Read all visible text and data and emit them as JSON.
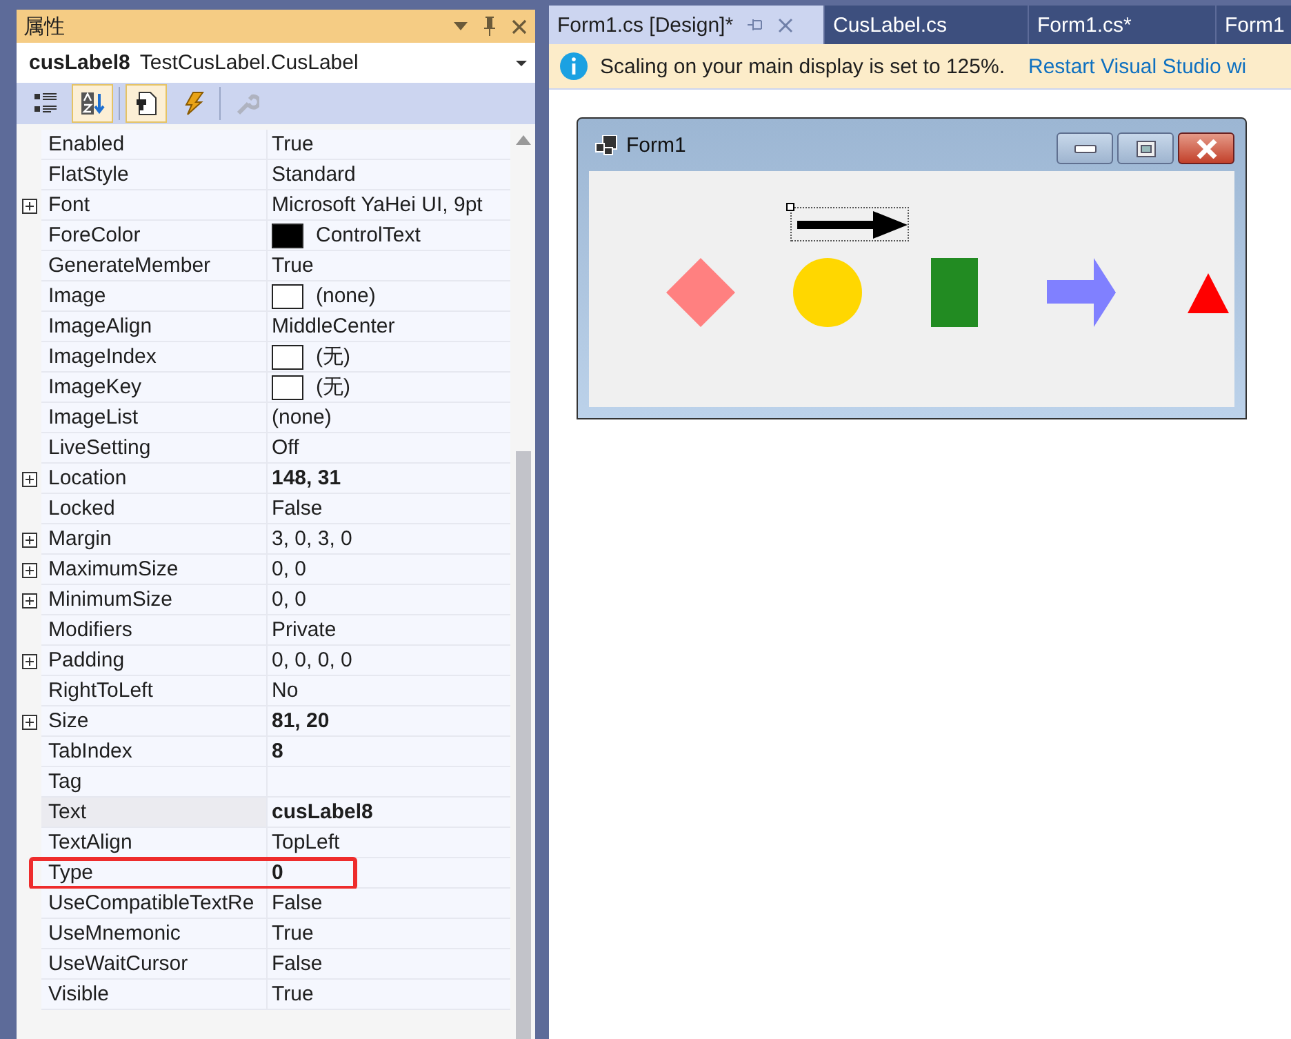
{
  "properties_panel": {
    "title": "属性",
    "object_name": "cusLabel8",
    "object_type": "TestCusLabel.CusLabel",
    "toolbar": [
      {
        "kind": "categorized",
        "selected": false,
        "disabled": false
      },
      {
        "kind": "alphabetical",
        "selected": true,
        "disabled": false
      },
      {
        "kind": "properties",
        "selected": true,
        "disabled": false
      },
      {
        "kind": "events",
        "selected": false,
        "disabled": false
      },
      {
        "kind": "property-pages",
        "selected": false,
        "disabled": true
      }
    ],
    "rows": [
      {
        "name": "Enabled",
        "value": "True",
        "expandable": false,
        "bold": false,
        "selected": false,
        "highlighted": false
      },
      {
        "name": "FlatStyle",
        "value": "Standard",
        "expandable": false,
        "bold": false,
        "selected": false,
        "highlighted": false
      },
      {
        "name": "Font",
        "value": "Microsoft YaHei UI, 9pt",
        "expandable": true,
        "bold": false,
        "selected": false,
        "highlighted": false
      },
      {
        "name": "ForeColor",
        "value": "ControlText",
        "color": "#000000",
        "expandable": false,
        "bold": false,
        "selected": false,
        "highlighted": false
      },
      {
        "name": "GenerateMember",
        "value": "True",
        "expandable": false,
        "bold": false,
        "selected": false,
        "highlighted": false
      },
      {
        "name": "Image",
        "value": "(none)",
        "color": "#ffffff",
        "expandable": false,
        "bold": false,
        "selected": false,
        "highlighted": false
      },
      {
        "name": "ImageAlign",
        "value": "MiddleCenter",
        "expandable": false,
        "bold": false,
        "selected": false,
        "highlighted": false
      },
      {
        "name": "ImageIndex",
        "value": "(无)",
        "color": "#ffffff",
        "expandable": false,
        "bold": false,
        "selected": false,
        "highlighted": false
      },
      {
        "name": "ImageKey",
        "value": "(无)",
        "color": "#ffffff",
        "expandable": false,
        "bold": false,
        "selected": false,
        "highlighted": false
      },
      {
        "name": "ImageList",
        "value": "(none)",
        "expandable": false,
        "bold": false,
        "selected": false,
        "highlighted": false
      },
      {
        "name": "LiveSetting",
        "value": "Off",
        "expandable": false,
        "bold": false,
        "selected": false,
        "highlighted": false
      },
      {
        "name": "Location",
        "value": "148, 31",
        "expandable": true,
        "bold": true,
        "selected": false,
        "highlighted": false
      },
      {
        "name": "Locked",
        "value": "False",
        "expandable": false,
        "bold": false,
        "selected": false,
        "highlighted": false
      },
      {
        "name": "Margin",
        "value": "3, 0, 3, 0",
        "expandable": true,
        "bold": false,
        "selected": false,
        "highlighted": false
      },
      {
        "name": "MaximumSize",
        "value": "0, 0",
        "expandable": true,
        "bold": false,
        "selected": false,
        "highlighted": false
      },
      {
        "name": "MinimumSize",
        "value": "0, 0",
        "expandable": true,
        "bold": false,
        "selected": false,
        "highlighted": false
      },
      {
        "name": "Modifiers",
        "value": "Private",
        "expandable": false,
        "bold": false,
        "selected": false,
        "highlighted": false
      },
      {
        "name": "Padding",
        "value": "0, 0, 0, 0",
        "expandable": true,
        "bold": false,
        "selected": false,
        "highlighted": false
      },
      {
        "name": "RightToLeft",
        "value": "No",
        "expandable": false,
        "bold": false,
        "selected": false,
        "highlighted": false
      },
      {
        "name": "Size",
        "value": "81, 20",
        "expandable": true,
        "bold": true,
        "selected": false,
        "highlighted": false
      },
      {
        "name": "TabIndex",
        "value": "8",
        "expandable": false,
        "bold": true,
        "selected": false,
        "highlighted": false
      },
      {
        "name": "Tag",
        "expandable": false,
        "selected": false,
        "highlighted": false
      },
      {
        "name": "Text",
        "value": "cusLabel8",
        "expandable": false,
        "bold": true,
        "selected": true,
        "highlighted": false
      },
      {
        "name": "TextAlign",
        "value": "TopLeft",
        "expandable": false,
        "bold": false,
        "selected": false,
        "highlighted": false
      },
      {
        "name": "Type",
        "value": "0",
        "expandable": false,
        "bold": true,
        "selected": false,
        "highlighted": true
      },
      {
        "name": "UseCompatibleTextRe",
        "value": "False",
        "expandable": false,
        "bold": false,
        "selected": false,
        "highlighted": false
      },
      {
        "name": "UseMnemonic",
        "value": "True",
        "expandable": false,
        "bold": false,
        "selected": false,
        "highlighted": false
      },
      {
        "name": "UseWaitCursor",
        "value": "False",
        "expandable": false,
        "bold": false,
        "selected": false,
        "highlighted": false
      },
      {
        "name": "Visible",
        "value": "True",
        "expandable": false,
        "bold": false,
        "selected": false,
        "highlighted": false
      }
    ]
  },
  "document_tabs": [
    {
      "label": "Form1.cs [Design]*",
      "selected": true
    },
    {
      "label": "CusLabel.cs",
      "selected": false
    },
    {
      "label": "Form1.cs*",
      "selected": false
    },
    {
      "label": "Form1",
      "selected": false
    }
  ],
  "info_bar": {
    "message": "Scaling on your main display is set to 125%.",
    "link": "Restart Visual Studio wi"
  },
  "form": {
    "title": "Form1",
    "shapes": [
      {
        "kind": "diamond",
        "color": "#ff8080"
      },
      {
        "kind": "circle",
        "color": "#ffd700"
      },
      {
        "kind": "rect",
        "color": "#228b22"
      },
      {
        "kind": "arrow",
        "color": "#8080ff"
      },
      {
        "kind": "triangle",
        "color": "#ff0000"
      }
    ]
  }
}
